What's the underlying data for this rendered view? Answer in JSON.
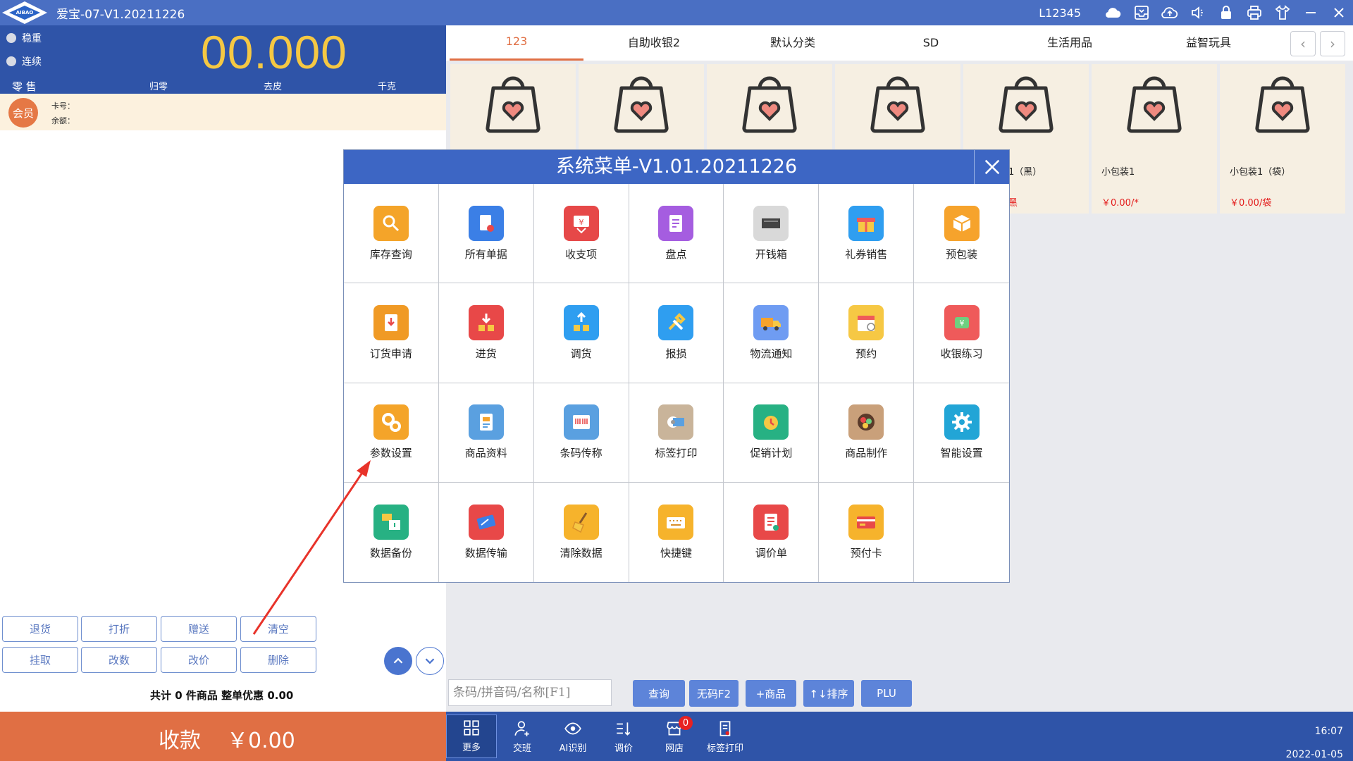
{
  "window": {
    "logo_text": "AIBAO",
    "title": "爱宝-07-V1.20211226",
    "account": "L12345",
    "icons": [
      "cloud-icon",
      "inbox-icon",
      "cloud-upload-icon",
      "volume-icon",
      "lock-icon",
      "printer-icon",
      "shirt-icon",
      "minimize-icon",
      "close-icon"
    ]
  },
  "scale": {
    "radio_stable": "稳重",
    "radio_continuous": "连续",
    "weight": "00.000",
    "mode": "零 售",
    "zero": "归零",
    "tare": "去皮",
    "unit": "千克"
  },
  "member": {
    "avatar": "会员",
    "card_label": "卡号：",
    "balance_label": "余额："
  },
  "function_buttons": {
    "row1": [
      "退货",
      "打折",
      "赠送",
      "清空"
    ],
    "row2": [
      "挂取",
      "改数",
      "改价",
      "删除"
    ]
  },
  "summary": "共计 0 件商品 整单优惠 0.00",
  "payment": {
    "label": "收款",
    "amount": "￥0.00"
  },
  "tabs": [
    "123",
    "自助收银2",
    "默认分类",
    "SD",
    "生活用品",
    "益智玩具"
  ],
  "products": [
    {
      "name": "",
      "price": ""
    },
    {
      "name": "",
      "price": ""
    },
    {
      "name": "",
      "price": ""
    },
    {
      "name": "",
      "price": ""
    },
    {
      "name": "1（黑）",
      "price": "黑"
    },
    {
      "name": "小包装1",
      "price": "￥0.00/*"
    },
    {
      "name": "小包装1（袋）",
      "price": "￥0.00/袋"
    }
  ],
  "search": {
    "placeholder": "条码/拼音码/名称[F1]"
  },
  "actions": [
    "查询",
    "无码F2",
    "+商品",
    "↑↓排序",
    "PLU"
  ],
  "bottom_nav": [
    {
      "label": "更多",
      "icon": "grid-icon"
    },
    {
      "label": "交班",
      "icon": "user-shift-icon"
    },
    {
      "label": "AI识别",
      "icon": "ai-eye-icon"
    },
    {
      "label": "调价",
      "icon": "sort-icon"
    },
    {
      "label": "网店",
      "icon": "store-icon",
      "badge": "0"
    },
    {
      "label": "标签打印",
      "icon": "label-print-icon"
    }
  ],
  "clock": {
    "time": "16:07",
    "date": "2022-01-05"
  },
  "modal": {
    "title": "系统菜单-V1.01.20211226",
    "items": [
      {
        "label": "库存查询",
        "icon": "stock-search-icon",
        "color": "#f4a429"
      },
      {
        "label": "所有单据",
        "icon": "documents-icon",
        "color": "#3b7fe6"
      },
      {
        "label": "收支项",
        "icon": "income-expense-icon",
        "color": "#e64848"
      },
      {
        "label": "盘点",
        "icon": "inventory-check-icon",
        "color": "#a55de0"
      },
      {
        "label": "开钱箱",
        "icon": "cash-drawer-icon",
        "color": "#d9d9d9"
      },
      {
        "label": "礼券销售",
        "icon": "gift-icon",
        "color": "#2f9ef0"
      },
      {
        "label": "预包装",
        "icon": "package-icon",
        "color": "#f6a32c"
      },
      {
        "label": "订货申请",
        "icon": "order-request-icon",
        "color": "#f09a25"
      },
      {
        "label": "进货",
        "icon": "stock-in-icon",
        "color": "#e84848"
      },
      {
        "label": "调货",
        "icon": "transfer-icon",
        "color": "#2f9ef0"
      },
      {
        "label": "报损",
        "icon": "tools-icon",
        "color": "#2f9ef0"
      },
      {
        "label": "物流通知",
        "icon": "truck-icon",
        "color": "#6f9cf2"
      },
      {
        "label": "预约",
        "icon": "calendar-icon",
        "color": "#f6c844"
      },
      {
        "label": "收银练习",
        "icon": "practice-icon",
        "color": "#ef5a5a"
      },
      {
        "label": "参数设置",
        "icon": "gears-icon",
        "color": "#f4a429"
      },
      {
        "label": "商品资料",
        "icon": "product-info-icon",
        "color": "#5aa0e0"
      },
      {
        "label": "条码传称",
        "icon": "barcode-scale-icon",
        "color": "#5aa0e0"
      },
      {
        "label": "标签打印",
        "icon": "label-roll-icon",
        "color": "#c9b49a"
      },
      {
        "label": "促销计划",
        "icon": "alarm-clock-icon",
        "color": "#27b183"
      },
      {
        "label": "商品制作",
        "icon": "food-bowl-icon",
        "color": "#c9a07a"
      },
      {
        "label": "智能设置",
        "icon": "gear-icon",
        "color": "#22a5d6"
      },
      {
        "label": "数据备份",
        "icon": "backup-icon",
        "color": "#27b183"
      },
      {
        "label": "数据传输",
        "icon": "data-transfer-icon",
        "color": "#e84848"
      },
      {
        "label": "清除数据",
        "icon": "broom-icon",
        "color": "#f6b32c"
      },
      {
        "label": "快捷键",
        "icon": "keyboard-icon",
        "color": "#f6b32c"
      },
      {
        "label": "调价单",
        "icon": "price-sheet-icon",
        "color": "#e84848"
      },
      {
        "label": "预付卡",
        "icon": "prepaid-card-icon",
        "color": "#f6b32c"
      },
      {
        "label": "",
        "icon": "",
        "color": ""
      }
    ]
  },
  "colors": {
    "title_bar": "#4a6fc3",
    "scale_panel": "#2f54a8",
    "accent_orange": "#e06f44",
    "weight_digits": "#f5c843",
    "price_red": "#e31b1b",
    "annotation_arrow": "#e8332a"
  }
}
